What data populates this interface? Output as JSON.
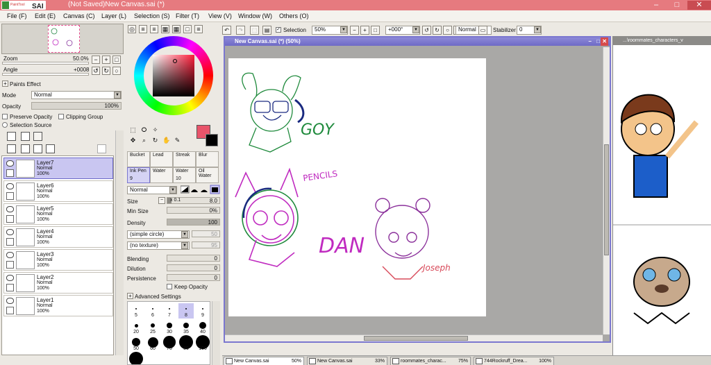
{
  "window": {
    "app_logo": "PaintTool SAI",
    "title": "(Not Saved)New Canvas.sai (*)",
    "controls": [
      "–",
      "□",
      "✕"
    ]
  },
  "menu": [
    "File (F)",
    "Edit (E)",
    "Canvas (C)",
    "Layer (L)",
    "Selection (S)",
    "Filter (T)",
    "View (V)",
    "Window (W)",
    "Others (O)"
  ],
  "navigator": {
    "zoom_label": "Zoom",
    "zoom_value": "50.0%",
    "angle_label": "Angle",
    "angle_value": "+0008"
  },
  "layer_panel": {
    "paints_effect": "Paints Effect",
    "mode_label": "Mode",
    "mode_value": "Normal",
    "opacity_label": "Opacity",
    "opacity_value": "100%",
    "preserve_opacity": "Preserve Opacity",
    "clipping_group": "Clipping Group",
    "selection_source": "Selection Source",
    "layers": [
      {
        "name": "Layer7",
        "mode": "Normal",
        "opacity": "100%",
        "selected": true
      },
      {
        "name": "Layer6",
        "mode": "Normal",
        "opacity": "100%"
      },
      {
        "name": "Layer5",
        "mode": "Normal",
        "opacity": "100%"
      },
      {
        "name": "Layer4",
        "mode": "Normal",
        "opacity": "100%"
      },
      {
        "name": "Layer3",
        "mode": "Normal",
        "opacity": "100%"
      },
      {
        "name": "Layer2",
        "mode": "Normal",
        "opacity": "100%"
      },
      {
        "name": "Layer1",
        "mode": "Normal",
        "opacity": "100%"
      }
    ]
  },
  "tools": {
    "brushes_row1": [
      "Bucket",
      "Lead",
      "Streak",
      "Blur"
    ],
    "brushes_row2": [
      "Ink Pen",
      "Water",
      "Water",
      "Oil Water"
    ],
    "brush_nums_row2": [
      "9",
      "",
      "10",
      ""
    ],
    "blend_mode": "Normal",
    "size_label": "Size",
    "size_mult": "x 0.1",
    "size_value": "8.0",
    "min_size_label": "Min Size",
    "min_size_value": "0%",
    "density_label": "Density",
    "density_value": "100",
    "shape": "(simple circle)",
    "shape_value": "50",
    "texture": "(no texture)",
    "texture_value": "95",
    "blending_label": "Blending",
    "blending_value": "0",
    "dilution_label": "Dilution",
    "dilution_value": "0",
    "persistence_label": "Persistence",
    "persistence_value": "0",
    "keep_opacity": "Keep Opacity",
    "advanced": "Advanced Settings",
    "size_presets": [
      "5",
      "6",
      "7",
      "8",
      "9",
      "20",
      "25",
      "30",
      "35",
      "40",
      "50",
      "60",
      "70",
      "80",
      "100",
      "120"
    ]
  },
  "toolbar": {
    "selection_label": "Selection",
    "zoom": "50%",
    "angle": "+000°",
    "blend": "Normal",
    "stabilizer_label": "Stabilizer",
    "stabilizer_value": "0"
  },
  "document": {
    "title": "New Canvas.sai (*) (50%)"
  },
  "side_document": {
    "title": "...\\roommates_characters_v"
  },
  "tabs": [
    {
      "name": "New Canvas.sai",
      "zoom": "50%",
      "active": true
    },
    {
      "name": "New Canvas.sai",
      "zoom": "33%"
    },
    {
      "name": "roommates_charac...",
      "zoom": "75%"
    },
    {
      "name": "744Rockruff_Drea...",
      "zoom": "100%"
    }
  ],
  "canvas_text": {
    "goy": "GOY",
    "pencils": "PENCILS",
    "dan": "DAN",
    "joseph": "Joseph"
  },
  "colors": {
    "titlebar": "#e67a7f",
    "selection": "#c9c6f1",
    "primary": "#e8546a",
    "secondary": "#000000"
  }
}
